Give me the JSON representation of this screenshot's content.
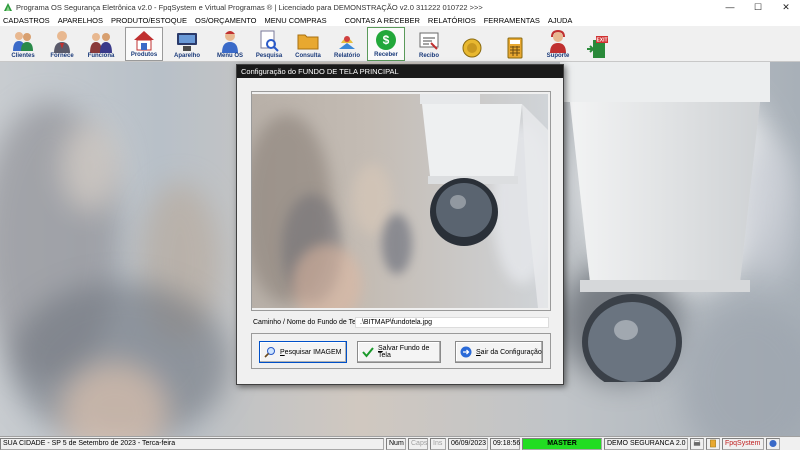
{
  "window": {
    "title": "Programa OS Segurança Eletrônica v2.0 - FpqSystem e Virtual Programas ® | Licenciado para  DEMONSTRAÇÃO v2.0 311222 010722 >>>",
    "minimize": "—",
    "maximize": "☐",
    "close": "✕"
  },
  "menu": [
    "CADASTROS",
    "APARELHOS",
    "PRODUTO/ESTOQUE",
    "OS/ORÇAMENTO",
    "MENU COMPRAS",
    "CONTAS A RECEBER",
    "RELATÓRIOS",
    "FERRAMENTAS",
    "AJUDA"
  ],
  "toolbar": {
    "clientes": "Clientes",
    "fornece": "Fornece",
    "funciona": "Funciona",
    "produtos": "Produtos",
    "aparelho": "Aparelho",
    "menu_os": "Menu OS",
    "pesquisa": "Pesquisa",
    "consulta": "Consulta",
    "relatorio": "Relatório",
    "receber": "Receber",
    "recibo": "Recibo",
    "suporte": "Suporte",
    "exit_sign": "EXIT"
  },
  "dialog": {
    "title": "Configuração do FUNDO DE TELA PRINCIPAL",
    "path_label": "Caminho / Nome do Fundo de Tela",
    "path_value": ".\\BITMAP\\fundotela.jpg",
    "btn_search_pre": "P",
    "btn_search_rest": "esquisar IMAGEM",
    "btn_save_pre": "S",
    "btn_save_rest": "alvar Fundo de Tela",
    "btn_exit_pre": "S",
    "btn_exit_rest": "air da Configuração"
  },
  "status": {
    "city": "SUA CIDADE - SP  5 de Setembro de 2023 - Terca-feira",
    "num": "Num",
    "caps": "Caps",
    "ins": "Ins",
    "date": "06/09/2023",
    "time": "09:18:56",
    "user": "MASTER",
    "company": "DEMO SEGURANCA 2.0",
    "brand": "FpqSystem"
  },
  "colors": {
    "dialog_title_bg": "#1a1a1a",
    "status_user_bg": "#22dd22",
    "toolbar_label": "#1a3a7a"
  }
}
